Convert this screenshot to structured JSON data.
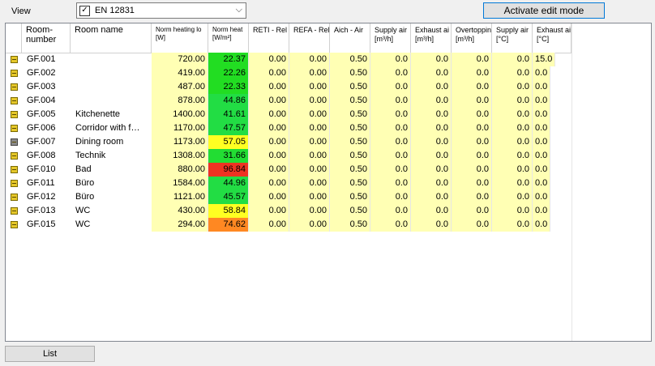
{
  "toolbar": {
    "view_label": "View",
    "view_selected": "EN 12831",
    "edit_button": "Activate edit mode"
  },
  "table": {
    "headers": [
      "Room-\nnumber",
      "Room name",
      "Norm heating lo\n[W]",
      "Norm heat\n[W/m²]",
      "RETI - Rel",
      "REFA - Rel",
      "Aich - Air",
      "Supply air\n[m³/h]",
      "Exhaust ai\n[m³/h]",
      "Overtoppin\n[m³/h]",
      "Supply air\n[°C]",
      "Exhaust ai\n[°C]"
    ],
    "rows": [
      {
        "icon": "room-icon",
        "num": "GF.001",
        "name": "",
        "heat": "720.00",
        "spec": "22.37",
        "color": "#22dd22",
        "reti": "0.00",
        "refa": "0.00",
        "aich": "0.50",
        "sup": "0.0",
        "exh": "0.0",
        "over": "0.0",
        "supt": "0.0",
        "exht": "15.0"
      },
      {
        "icon": "room-icon",
        "num": "GF.002",
        "name": "",
        "heat": "419.00",
        "spec": "22.26",
        "color": "#22dd22",
        "reti": "0.00",
        "refa": "0.00",
        "aich": "0.50",
        "sup": "0.0",
        "exh": "0.0",
        "over": "0.0",
        "supt": "0.0",
        "exht": "0.0"
      },
      {
        "icon": "room-icon",
        "num": "GF.003",
        "name": "",
        "heat": "487.00",
        "spec": "22.33",
        "color": "#22dd22",
        "reti": "0.00",
        "refa": "0.00",
        "aich": "0.50",
        "sup": "0.0",
        "exh": "0.0",
        "over": "0.0",
        "supt": "0.0",
        "exht": "0.0"
      },
      {
        "icon": "room-icon",
        "num": "GF.004",
        "name": "",
        "heat": "878.00",
        "spec": "44.86",
        "color": "#22dd44",
        "reti": "0.00",
        "refa": "0.00",
        "aich": "0.50",
        "sup": "0.0",
        "exh": "0.0",
        "over": "0.0",
        "supt": "0.0",
        "exht": "0.0"
      },
      {
        "icon": "room-icon",
        "num": "GF.005",
        "name": "Kitchenette",
        "heat": "1400.00",
        "spec": "41.61",
        "color": "#22dd44",
        "reti": "0.00",
        "refa": "0.00",
        "aich": "0.50",
        "sup": "0.0",
        "exh": "0.0",
        "over": "0.0",
        "supt": "0.0",
        "exht": "0.0"
      },
      {
        "icon": "room-icon",
        "num": "GF.006",
        "name": "Corridor with f…",
        "heat": "1170.00",
        "spec": "47.57",
        "color": "#22dd44",
        "reti": "0.00",
        "refa": "0.00",
        "aich": "0.50",
        "sup": "0.0",
        "exh": "0.0",
        "over": "0.0",
        "supt": "0.0",
        "exht": "0.0"
      },
      {
        "icon": "room-icon-grey",
        "num": "GF.007",
        "name": "Dining room",
        "heat": "1173.00",
        "spec": "57.05",
        "color": "#ffff22",
        "reti": "0.00",
        "refa": "0.00",
        "aich": "0.50",
        "sup": "0.0",
        "exh": "0.0",
        "over": "0.0",
        "supt": "0.0",
        "exht": "0.0"
      },
      {
        "icon": "room-icon",
        "num": "GF.008",
        "name": "Technik",
        "heat": "1308.00",
        "spec": "31.66",
        "color": "#22dd33",
        "reti": "0.00",
        "refa": "0.00",
        "aich": "0.50",
        "sup": "0.0",
        "exh": "0.0",
        "over": "0.0",
        "supt": "0.0",
        "exht": "0.0"
      },
      {
        "icon": "room-icon",
        "num": "GF.010",
        "name": "Bad",
        "heat": "880.00",
        "spec": "96.84",
        "color": "#ee3322",
        "reti": "0.00",
        "refa": "0.00",
        "aich": "0.50",
        "sup": "0.0",
        "exh": "0.0",
        "over": "0.0",
        "supt": "0.0",
        "exht": "0.0"
      },
      {
        "icon": "room-icon",
        "num": "GF.011",
        "name": "Büro",
        "heat": "1584.00",
        "spec": "44.96",
        "color": "#22dd44",
        "reti": "0.00",
        "refa": "0.00",
        "aich": "0.50",
        "sup": "0.0",
        "exh": "0.0",
        "over": "0.0",
        "supt": "0.0",
        "exht": "0.0"
      },
      {
        "icon": "room-icon",
        "num": "GF.012",
        "name": "Büro",
        "heat": "1121.00",
        "spec": "45.57",
        "color": "#22dd44",
        "reti": "0.00",
        "refa": "0.00",
        "aich": "0.50",
        "sup": "0.0",
        "exh": "0.0",
        "over": "0.0",
        "supt": "0.0",
        "exht": "0.0"
      },
      {
        "icon": "room-icon",
        "num": "GF.013",
        "name": "WC",
        "heat": "430.00",
        "spec": "58.84",
        "color": "#ffff22",
        "reti": "0.00",
        "refa": "0.00",
        "aich": "0.50",
        "sup": "0.0",
        "exh": "0.0",
        "over": "0.0",
        "supt": "0.0",
        "exht": "0.0"
      },
      {
        "icon": "room-icon",
        "num": "GF.015",
        "name": "WC",
        "heat": "294.00",
        "spec": "74.62",
        "color": "#ff8822",
        "reti": "0.00",
        "refa": "0.00",
        "aich": "0.50",
        "sup": "0.0",
        "exh": "0.0",
        "over": "0.0",
        "supt": "0.0",
        "exht": "0.0"
      }
    ]
  },
  "footer": {
    "list_button": "List"
  }
}
